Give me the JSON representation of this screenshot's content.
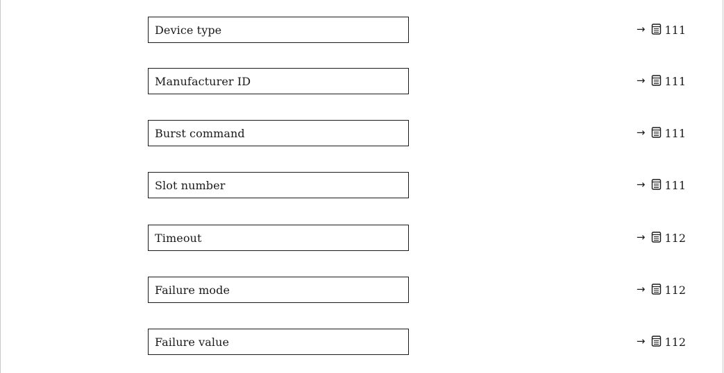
{
  "parameters": [
    {
      "label": "Device type",
      "arrow": "→",
      "icon": "book-icon",
      "page": "111"
    },
    {
      "label": "Manufacturer ID",
      "arrow": "→",
      "icon": "book-icon",
      "page": "111"
    },
    {
      "label": "Burst command",
      "arrow": "→",
      "icon": "book-icon",
      "page": "111"
    },
    {
      "label": "Slot number",
      "arrow": "→",
      "icon": "book-icon",
      "page": "111"
    },
    {
      "label": "Timeout",
      "arrow": "→",
      "icon": "book-icon",
      "page": "112"
    },
    {
      "label": "Failure mode",
      "arrow": "→",
      "icon": "book-icon",
      "page": "112"
    },
    {
      "label": "Failure value",
      "arrow": "→",
      "icon": "book-icon",
      "page": "112"
    }
  ]
}
